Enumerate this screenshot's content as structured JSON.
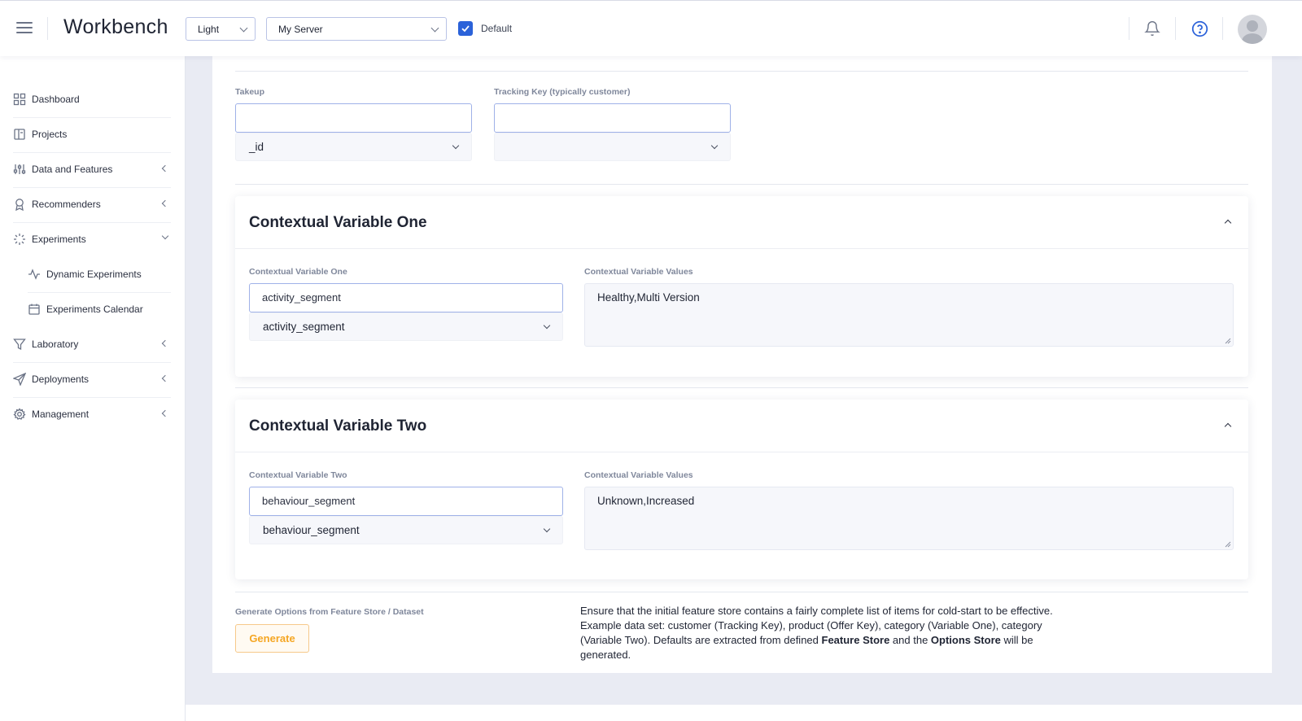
{
  "header": {
    "app_title": "Workbench",
    "theme_select": "Light",
    "server_select": "My Server",
    "default_checkbox_label": "Default",
    "default_checked": true,
    "accent_color": "#2b62d9"
  },
  "sidebar": {
    "items": [
      {
        "label": "Dashboard",
        "icon": "grid-icon"
      },
      {
        "label": "Projects",
        "icon": "book-icon"
      },
      {
        "label": "Data and Features",
        "icon": "sliders-icon"
      },
      {
        "label": "Recommenders",
        "icon": "award-icon"
      },
      {
        "label": "Experiments",
        "icon": "loader-icon"
      },
      {
        "label": "Dynamic Experiments",
        "icon": "activity-icon"
      },
      {
        "label": "Experiments Calendar",
        "icon": "calendar-icon"
      },
      {
        "label": "Laboratory",
        "icon": "filter-icon"
      },
      {
        "label": "Deployments",
        "icon": "send-icon"
      },
      {
        "label": "Management",
        "icon": "gear-icon"
      }
    ]
  },
  "takeup": {
    "label": "Takeup",
    "input_value": "",
    "select_value": "_id"
  },
  "tracking_key": {
    "label": "Tracking Key (typically customer)",
    "input_value": "",
    "select_value": ""
  },
  "variable_one": {
    "title": "Contextual Variable One",
    "field_label": "Contextual Variable One",
    "input_value": "activity_segment",
    "select_value": "activity_segment",
    "values_label": "Contextual Variable Values",
    "values": "Healthy,Multi Version"
  },
  "variable_two": {
    "title": "Contextual Variable Two",
    "field_label": "Contextual Variable Two",
    "input_value": "behaviour_segment",
    "select_value": "behaviour_segment",
    "values_label": "Contextual Variable Values",
    "values": "Unknown,Increased"
  },
  "generate": {
    "label": "Generate Options from Feature Store / Dataset",
    "button": "Generate",
    "note_part1": "Ensure that the initial feature store contains a fairly complete list of items for cold-start to be effective. Example data set: customer (Tracking Key), product (Offer Key), category (Variable One), category (Variable Two). Defaults are extracted from defined ",
    "note_bold1": "Feature Store",
    "note_part2": " and the ",
    "note_bold2": "Options Store",
    "note_part3": " will be generated."
  }
}
